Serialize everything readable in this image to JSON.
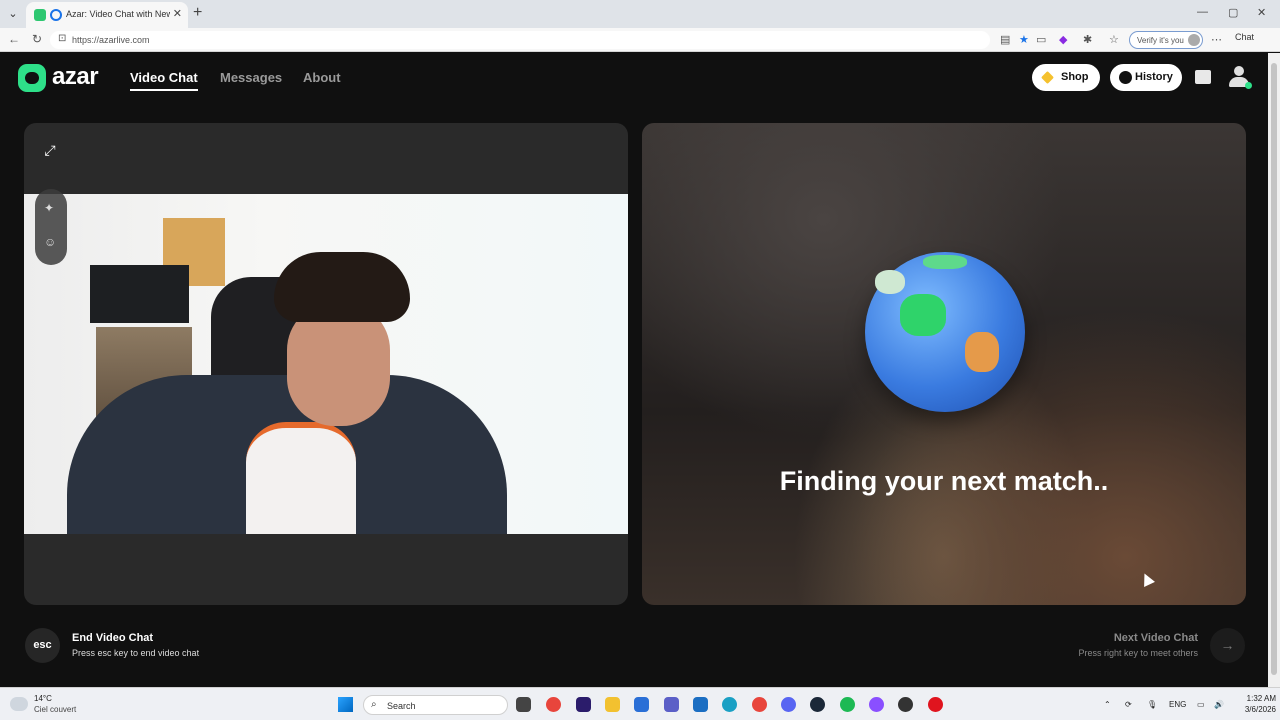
{
  "browser": {
    "tab_title": "Azar: Video Chat with New Pe",
    "url": "https://azarlive.com",
    "verify_label": "Verify it's you",
    "copilot_label": "Chat"
  },
  "header": {
    "brand": "azar",
    "nav": [
      "Video Chat",
      "Messages",
      "About"
    ],
    "shop_label": "Shop",
    "history_label": "History"
  },
  "remote_panel": {
    "status_text": "Finding your next match.."
  },
  "footer": {
    "esc_key": "esc",
    "end_title": "End Video Chat",
    "end_hint": "Press esc key to end video chat",
    "next_title": "Next Video Chat",
    "next_hint": "Press right key to meet others",
    "next_icon": "→"
  },
  "taskbar": {
    "temperature": "14°C",
    "condition": "Ciel couvert",
    "search_placeholder": "Search",
    "language": "ENG",
    "time": "1:32 AM",
    "date": "3/6/2026"
  },
  "colors": {
    "brand_green": "#2ee089",
    "page_bg": "#101010",
    "panel_bg": "#2a2a2a"
  }
}
